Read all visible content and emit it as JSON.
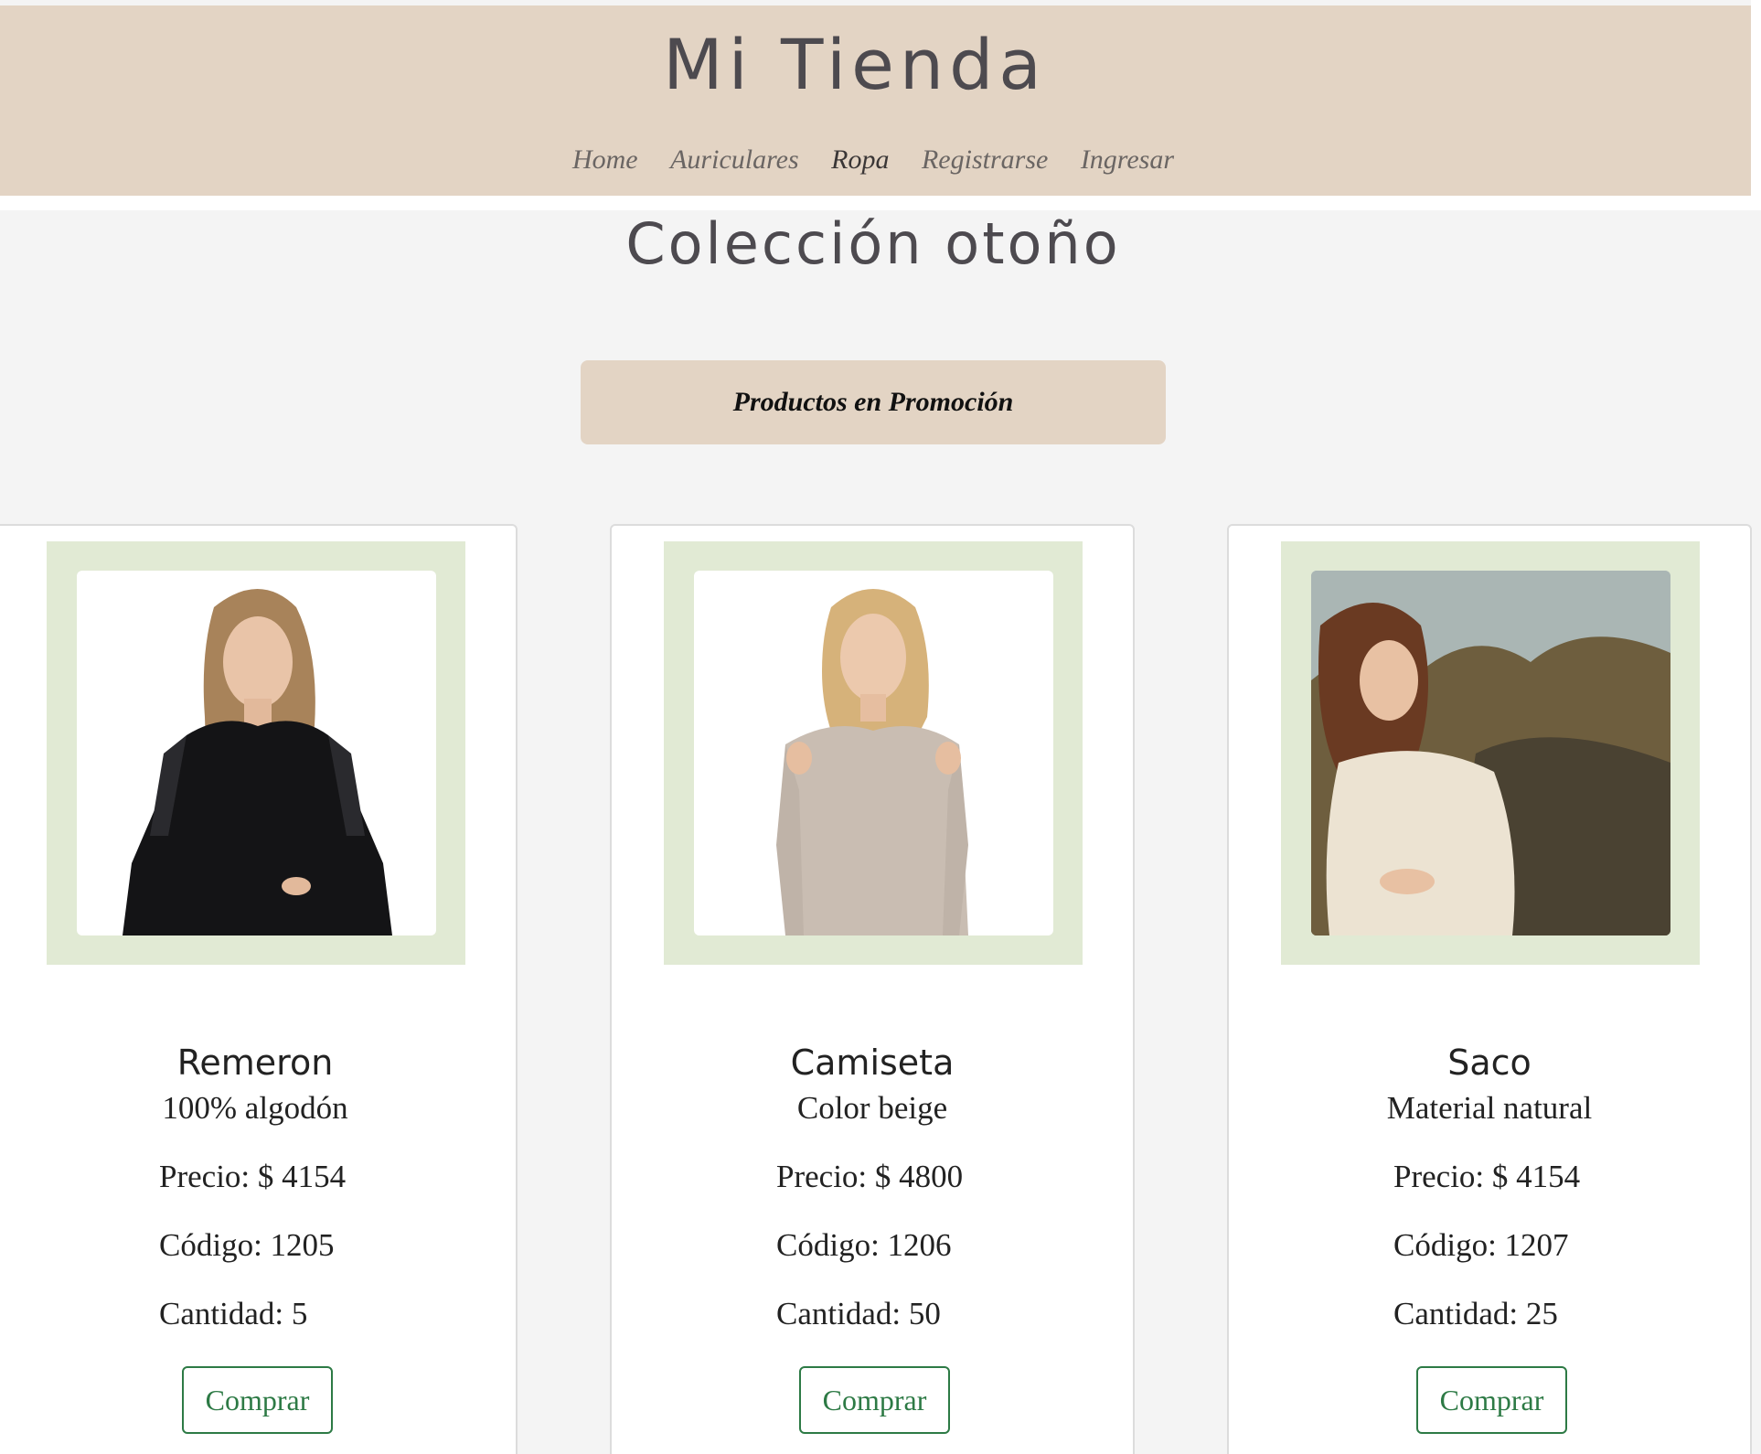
{
  "header": {
    "title": "Mi Tienda",
    "nav": [
      "Home",
      "Auriculares",
      "Ropa",
      "Registrarse",
      "Ingresar"
    ],
    "active_nav": "Ropa"
  },
  "collection": {
    "title": "Colección otoño",
    "promo_label": "Productos en Promoción"
  },
  "products": [
    {
      "name": "Remeron",
      "description": "100% algodón",
      "price": "Precio: $ 4154",
      "code": "Código: 1205",
      "quantity": "Cantidad: 5",
      "buy_label": "Comprar"
    },
    {
      "name": "Camiseta",
      "description": "Color beige",
      "price": "Precio: $ 4800",
      "code": "Código: 1206",
      "quantity": "Cantidad: 50",
      "buy_label": "Comprar"
    },
    {
      "name": "Saco",
      "description": "Material natural",
      "price": "Precio: $ 4154",
      "code": "Código: 1207",
      "quantity": "Cantidad: 25",
      "buy_label": "Comprar"
    }
  ],
  "colors": {
    "header_bg": "#e3d4c4",
    "image_frame": "#e1ead4",
    "button_green": "#2d7a45",
    "page_bg": "#f4f4f4"
  }
}
